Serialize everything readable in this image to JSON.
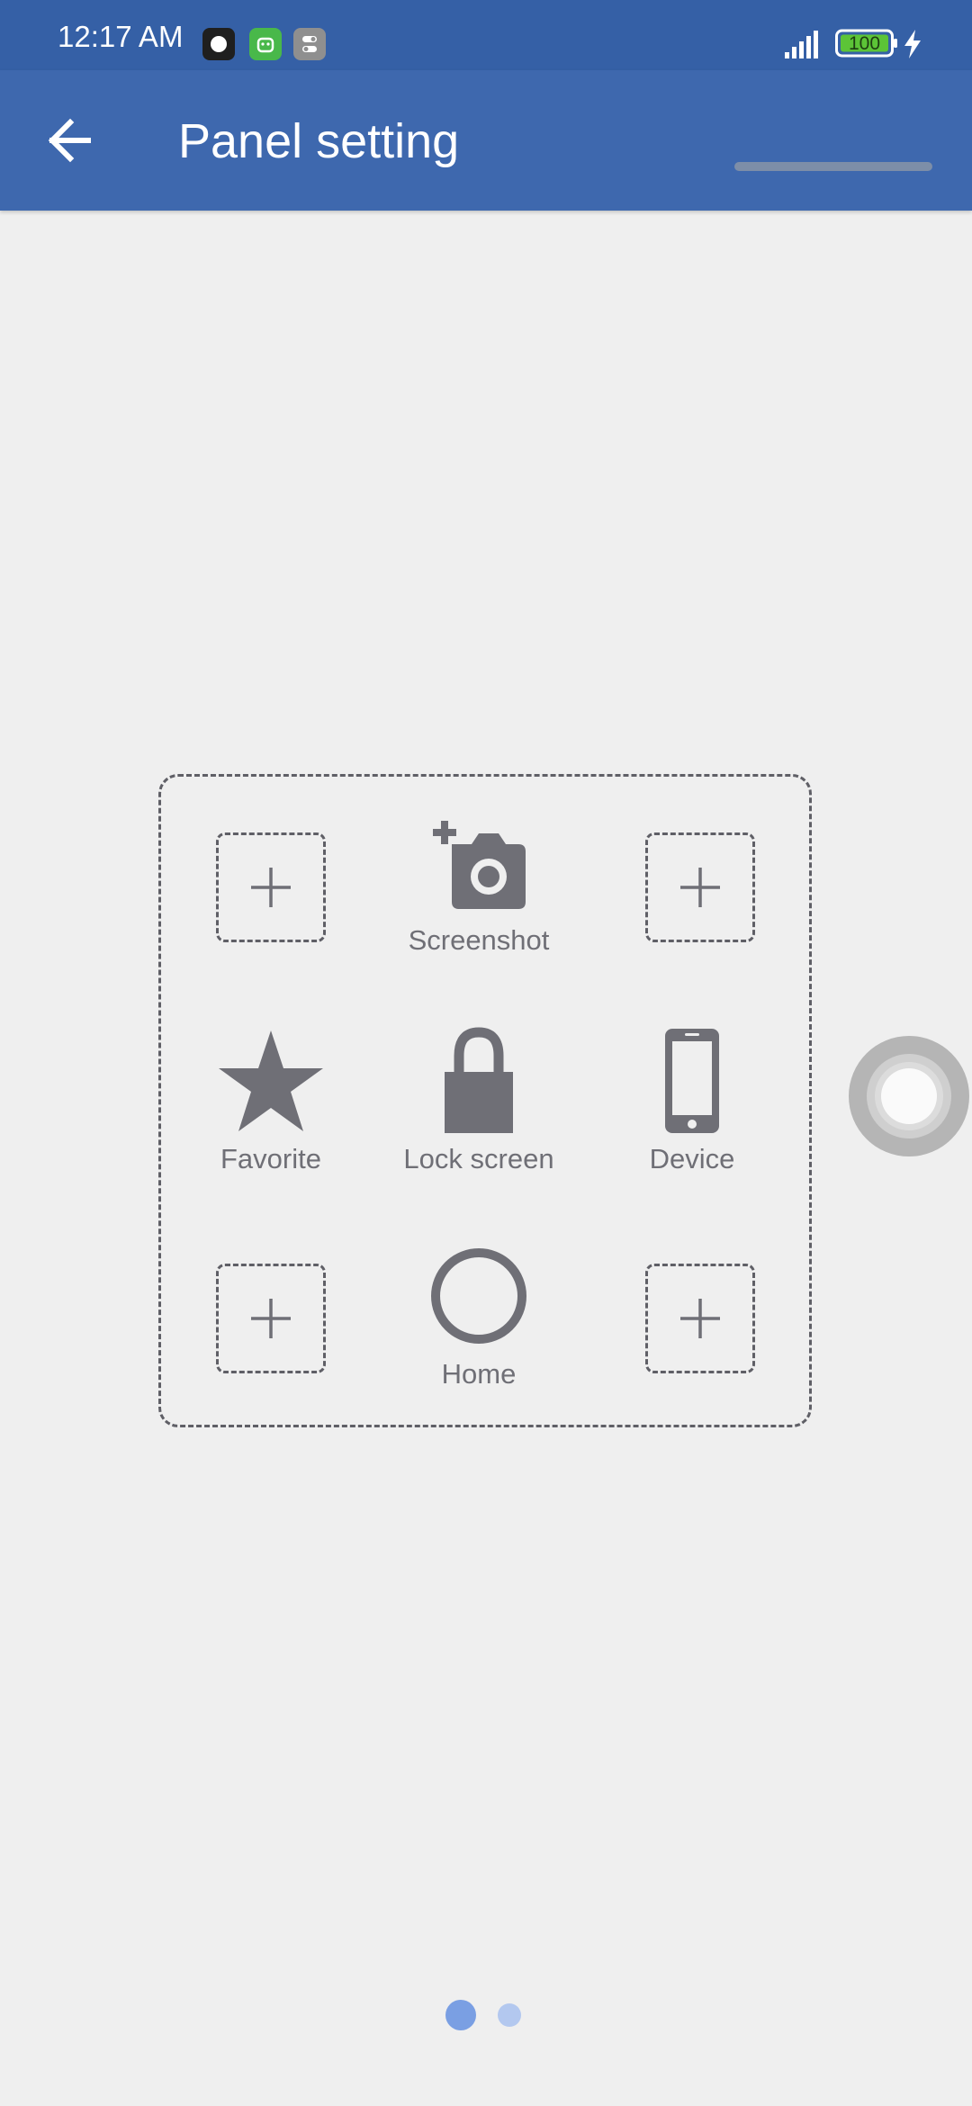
{
  "status_bar": {
    "time": "12:17 AM",
    "battery_level": "100",
    "icons": [
      "record-icon",
      "android-app-icon",
      "toggle-app-icon",
      "signal-icon",
      "battery-icon",
      "charging-icon"
    ]
  },
  "toolbar": {
    "title": "Panel setting",
    "back_icon": "arrow-left-icon"
  },
  "panel": {
    "slots": [
      {
        "kind": "add",
        "icon": "plus-icon"
      },
      {
        "kind": "action",
        "label": "Screenshot",
        "icon": "camera-plus-icon"
      },
      {
        "kind": "add",
        "icon": "plus-icon"
      },
      {
        "kind": "action",
        "label": "Favorite",
        "icon": "star-icon"
      },
      {
        "kind": "action",
        "label": "Lock screen",
        "icon": "lock-icon"
      },
      {
        "kind": "action",
        "label": "Device",
        "icon": "phone-icon"
      },
      {
        "kind": "add",
        "icon": "plus-icon"
      },
      {
        "kind": "action",
        "label": "Home",
        "icon": "circle-icon"
      },
      {
        "kind": "add",
        "icon": "plus-icon"
      }
    ]
  },
  "pager": {
    "pages": 2,
    "current": 1
  },
  "colors": {
    "status_bar": "#3560a6",
    "toolbar": "#3e68ae",
    "background": "#efefef",
    "icon_gray": "#6f6f76",
    "dot_active": "#7a9fe3",
    "dot_inactive": "#b3c8ef"
  }
}
